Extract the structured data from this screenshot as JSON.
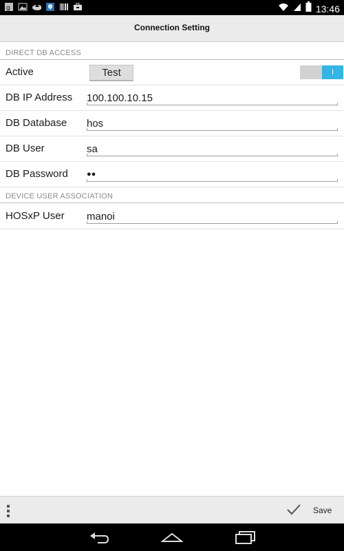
{
  "status_bar": {
    "time": "13:46",
    "icons": [
      "google-plus-icon",
      "image-icon",
      "cloud-upload-icon",
      "shield-icon",
      "barcode-icon",
      "briefcase-icon",
      "wifi-icon",
      "signal-icon",
      "battery-icon"
    ]
  },
  "header": {
    "title": "Connection Setting"
  },
  "sections": {
    "direct_db": "DIRECT DB ACCESS",
    "device_user": "DEVICE USER ASSOCIATION"
  },
  "form": {
    "active": {
      "label": "Active",
      "test_button": "Test",
      "toggle_value": "I",
      "toggle_on": true
    },
    "ip": {
      "label": "DB IP Address",
      "value": "100.100.10.15"
    },
    "database": {
      "label": "DB Database",
      "value": "hos"
    },
    "user": {
      "label": "DB User",
      "value": "sa"
    },
    "password": {
      "label": "DB Password",
      "value": "●●"
    },
    "hosxp_user": {
      "label": "HOSxP User",
      "value": "manoi"
    }
  },
  "bottom_bar": {
    "save_label": "Save"
  },
  "colors": {
    "accent": "#33b5e5",
    "bar_bg": "#ebebeb",
    "section_text": "#8a8a8a"
  }
}
